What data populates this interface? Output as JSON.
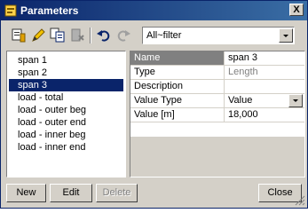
{
  "window": {
    "title": "Parameters",
    "close_glyph": "X"
  },
  "toolbar": {
    "icons": [
      "properties-icon",
      "edit-icon",
      "copy-icon",
      "delete-icon",
      "undo-icon",
      "redo-icon"
    ],
    "filter_value": "All~filter"
  },
  "list": {
    "items": [
      "span 1",
      "span 2",
      "span 3",
      "load - total",
      "load - outer beg",
      "load - outer end",
      "load - inner beg",
      "load - inner end"
    ],
    "selected_index": 2
  },
  "properties": {
    "rows": [
      {
        "label": "Name",
        "value": "span 3"
      },
      {
        "label": "Type",
        "value": "Length"
      },
      {
        "label": "Description",
        "value": ""
      },
      {
        "label": "Value Type",
        "value": "Value"
      },
      {
        "label": "Value [m]",
        "value": "18,000"
      }
    ]
  },
  "buttons": {
    "new": "New",
    "edit": "Edit",
    "delete": "Delete",
    "close": "Close"
  },
  "colors": {
    "titlebar": "#0a246a",
    "selection": "#0a246a",
    "face": "#d4d0c8"
  }
}
